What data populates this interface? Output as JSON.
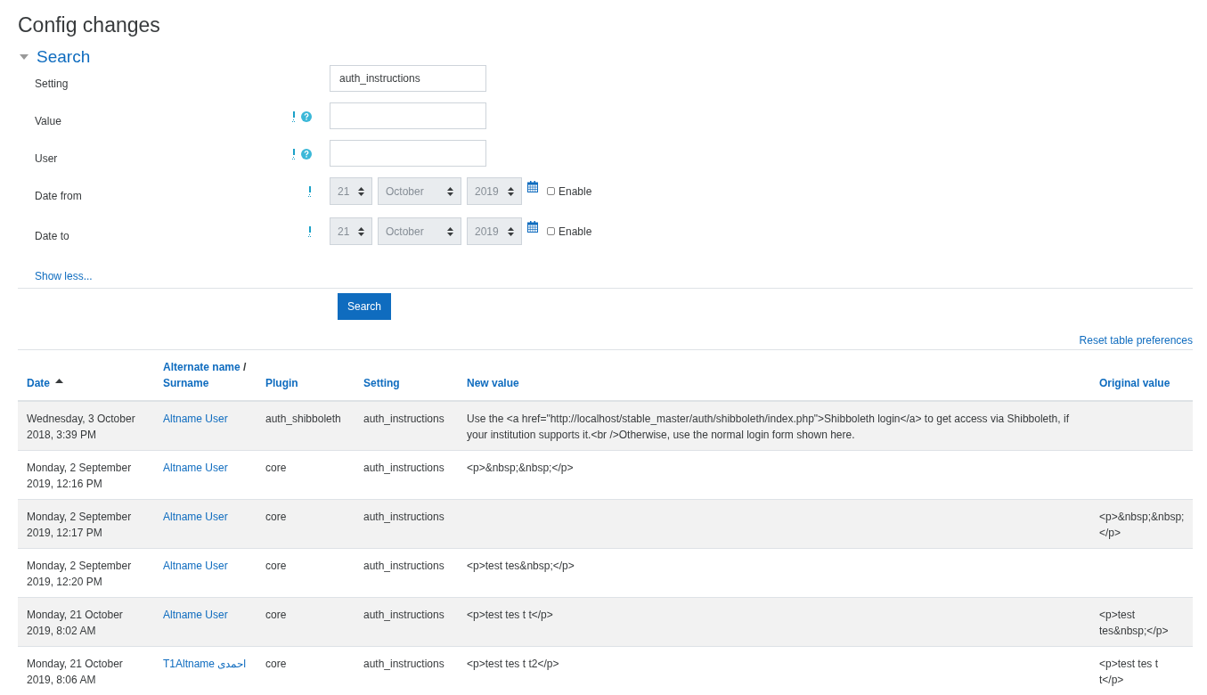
{
  "title": "Config changes",
  "search_section": {
    "title": "Search",
    "expanded": true,
    "fields": [
      {
        "kind": "text",
        "label": "Setting",
        "advanced": false,
        "help": false,
        "value": "auth_instructions"
      },
      {
        "kind": "text",
        "label": "Value",
        "advanced": true,
        "help": true
      },
      {
        "kind": "text",
        "label": "User",
        "advanced": true,
        "help": true
      },
      {
        "kind": "date",
        "label": "Date from",
        "advanced": true,
        "help": false,
        "day": "21",
        "month": "October",
        "year": "2019",
        "enable_label": "Enable",
        "checked": false
      },
      {
        "kind": "date",
        "label": "Date to",
        "advanced": true,
        "help": false,
        "day": "21",
        "month": "October",
        "year": "2019",
        "enable_label": "Enable",
        "checked": false
      }
    ],
    "show_less": "Show less...",
    "button": "Search"
  },
  "reset_link": "Reset table preferences",
  "table": {
    "columns": [
      {
        "parts": [
          "Date"
        ],
        "sorted": true
      },
      {
        "parts": [
          "Alternate name",
          "Surname"
        ],
        "separator": "/",
        "sorted": false
      },
      {
        "parts": [
          "Plugin"
        ],
        "sorted": false
      },
      {
        "parts": [
          "Setting"
        ],
        "sorted": false
      },
      {
        "parts": [
          "New value"
        ],
        "sorted": false
      },
      {
        "parts": [
          "Original value"
        ],
        "sorted": false
      }
    ],
    "rows": [
      {
        "date": "Wednesday, 3 October 2018, 3:39 PM",
        "user": "Altname User",
        "plugin": "auth_shibboleth",
        "setting": "auth_instructions",
        "new_value": "Use the <a href=\"http://localhost/stable_master/auth/shibboleth/index.php\">Shibboleth login</a> to get access via Shibboleth, if your institution supports it.<br />Otherwise, use the normal login form shown here."
      },
      {
        "date": "Monday, 2 September 2019, 12:16 PM",
        "user": "Altname User",
        "plugin": "core",
        "setting": "auth_instructions",
        "new_value": "<p>&nbsp;&nbsp;</p>"
      },
      {
        "date": "Monday, 2 September 2019, 12:17 PM",
        "user": "Altname User",
        "plugin": "core",
        "setting": "auth_instructions",
        "original_value": "<p>&nbsp;&nbsp;</p>"
      },
      {
        "date": "Monday, 2 September 2019, 12:20 PM",
        "user": "Altname User",
        "plugin": "core",
        "setting": "auth_instructions",
        "new_value": "<p>test tes&nbsp;</p>"
      },
      {
        "date": "Monday, 21 October 2019, 8:02 AM",
        "user": "Altname User",
        "plugin": "core",
        "setting": "auth_instructions",
        "new_value": "<p>test tes t t</p>",
        "original_value": "<p>test tes&nbsp;</p>"
      },
      {
        "date": "Monday, 21 October 2019, 8:06 AM",
        "user": "T1Altname احمدی",
        "plugin": "core",
        "setting": "auth_instructions",
        "new_value": "<p>test tes t t2</p>",
        "original_value": "<p>test tes t t</p>"
      }
    ]
  }
}
